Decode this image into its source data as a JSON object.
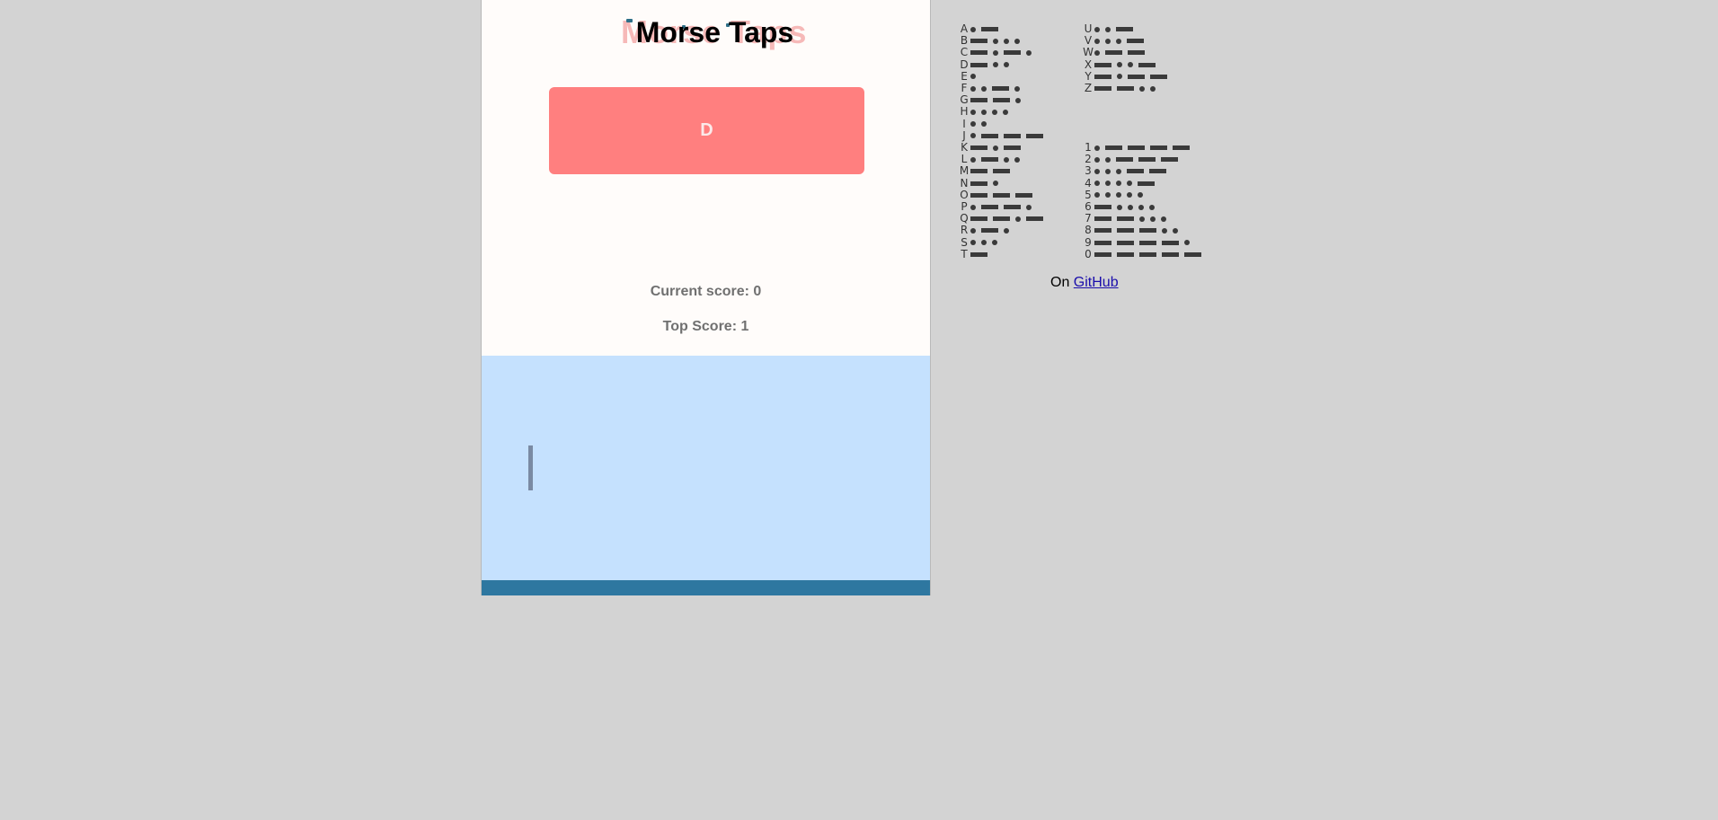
{
  "game": {
    "title": "Morse Taps",
    "title_shadow": "Morse Taps",
    "current_letter": "D",
    "current_score": "Current score: 0",
    "top_score": "Top Score: 1"
  },
  "reference": {
    "letters": [
      {
        "char": "A",
        "code": ".-"
      },
      {
        "char": "B",
        "code": "-..."
      },
      {
        "char": "C",
        "code": "-.-."
      },
      {
        "char": "D",
        "code": "-.."
      },
      {
        "char": "E",
        "code": "."
      },
      {
        "char": "F",
        "code": "..-."
      },
      {
        "char": "G",
        "code": "--."
      },
      {
        "char": "H",
        "code": "...."
      },
      {
        "char": "I",
        "code": ".."
      },
      {
        "char": "J",
        "code": ".---"
      },
      {
        "char": "K",
        "code": "-.-"
      },
      {
        "char": "L",
        "code": ".-.."
      },
      {
        "char": "M",
        "code": "--"
      },
      {
        "char": "N",
        "code": "-."
      },
      {
        "char": "O",
        "code": "---"
      },
      {
        "char": "P",
        "code": ".--."
      },
      {
        "char": "Q",
        "code": "--.-"
      },
      {
        "char": "R",
        "code": ".-."
      },
      {
        "char": "S",
        "code": "..."
      },
      {
        "char": "T",
        "code": "-"
      }
    ],
    "letters_right": [
      {
        "char": "U",
        "code": "..-"
      },
      {
        "char": "V",
        "code": "...-"
      },
      {
        "char": "W",
        "code": ".--"
      },
      {
        "char": "X",
        "code": "-..-"
      },
      {
        "char": "Y",
        "code": "-.--"
      },
      {
        "char": "Z",
        "code": "--.."
      }
    ],
    "digits": [
      {
        "char": "1",
        "code": ".----"
      },
      {
        "char": "2",
        "code": "..---"
      },
      {
        "char": "3",
        "code": "...--"
      },
      {
        "char": "4",
        "code": "....-"
      },
      {
        "char": "5",
        "code": "....."
      },
      {
        "char": "6",
        "code": "-...."
      },
      {
        "char": "7",
        "code": "--..."
      },
      {
        "char": "8",
        "code": "---.."
      },
      {
        "char": "9",
        "code": "----."
      },
      {
        "char": "0",
        "code": "-----"
      }
    ]
  },
  "footer": {
    "prefix": "On",
    "link_label": "GitHub"
  },
  "colors": {
    "background": "#d3d3d3",
    "letter_card": "#ff7f7f",
    "tap_area": "#c5e1fe",
    "bottom_bar": "#2e77a0"
  }
}
